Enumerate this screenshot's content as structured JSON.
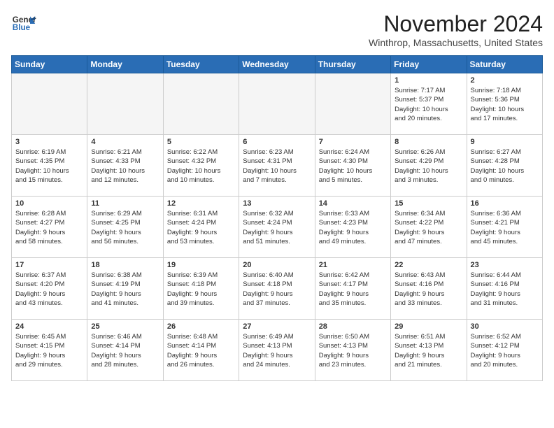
{
  "header": {
    "logo_general": "General",
    "logo_blue": "Blue",
    "month_title": "November 2024",
    "location": "Winthrop, Massachusetts, United States"
  },
  "weekdays": [
    "Sunday",
    "Monday",
    "Tuesday",
    "Wednesday",
    "Thursday",
    "Friday",
    "Saturday"
  ],
  "weeks": [
    [
      {
        "day": "",
        "info": ""
      },
      {
        "day": "",
        "info": ""
      },
      {
        "day": "",
        "info": ""
      },
      {
        "day": "",
        "info": ""
      },
      {
        "day": "",
        "info": ""
      },
      {
        "day": "1",
        "info": "Sunrise: 7:17 AM\nSunset: 5:37 PM\nDaylight: 10 hours\nand 20 minutes."
      },
      {
        "day": "2",
        "info": "Sunrise: 7:18 AM\nSunset: 5:36 PM\nDaylight: 10 hours\nand 17 minutes."
      }
    ],
    [
      {
        "day": "3",
        "info": "Sunrise: 6:19 AM\nSunset: 4:35 PM\nDaylight: 10 hours\nand 15 minutes."
      },
      {
        "day": "4",
        "info": "Sunrise: 6:21 AM\nSunset: 4:33 PM\nDaylight: 10 hours\nand 12 minutes."
      },
      {
        "day": "5",
        "info": "Sunrise: 6:22 AM\nSunset: 4:32 PM\nDaylight: 10 hours\nand 10 minutes."
      },
      {
        "day": "6",
        "info": "Sunrise: 6:23 AM\nSunset: 4:31 PM\nDaylight: 10 hours\nand 7 minutes."
      },
      {
        "day": "7",
        "info": "Sunrise: 6:24 AM\nSunset: 4:30 PM\nDaylight: 10 hours\nand 5 minutes."
      },
      {
        "day": "8",
        "info": "Sunrise: 6:26 AM\nSunset: 4:29 PM\nDaylight: 10 hours\nand 3 minutes."
      },
      {
        "day": "9",
        "info": "Sunrise: 6:27 AM\nSunset: 4:28 PM\nDaylight: 10 hours\nand 0 minutes."
      }
    ],
    [
      {
        "day": "10",
        "info": "Sunrise: 6:28 AM\nSunset: 4:27 PM\nDaylight: 9 hours\nand 58 minutes."
      },
      {
        "day": "11",
        "info": "Sunrise: 6:29 AM\nSunset: 4:25 PM\nDaylight: 9 hours\nand 56 minutes."
      },
      {
        "day": "12",
        "info": "Sunrise: 6:31 AM\nSunset: 4:24 PM\nDaylight: 9 hours\nand 53 minutes."
      },
      {
        "day": "13",
        "info": "Sunrise: 6:32 AM\nSunset: 4:24 PM\nDaylight: 9 hours\nand 51 minutes."
      },
      {
        "day": "14",
        "info": "Sunrise: 6:33 AM\nSunset: 4:23 PM\nDaylight: 9 hours\nand 49 minutes."
      },
      {
        "day": "15",
        "info": "Sunrise: 6:34 AM\nSunset: 4:22 PM\nDaylight: 9 hours\nand 47 minutes."
      },
      {
        "day": "16",
        "info": "Sunrise: 6:36 AM\nSunset: 4:21 PM\nDaylight: 9 hours\nand 45 minutes."
      }
    ],
    [
      {
        "day": "17",
        "info": "Sunrise: 6:37 AM\nSunset: 4:20 PM\nDaylight: 9 hours\nand 43 minutes."
      },
      {
        "day": "18",
        "info": "Sunrise: 6:38 AM\nSunset: 4:19 PM\nDaylight: 9 hours\nand 41 minutes."
      },
      {
        "day": "19",
        "info": "Sunrise: 6:39 AM\nSunset: 4:18 PM\nDaylight: 9 hours\nand 39 minutes."
      },
      {
        "day": "20",
        "info": "Sunrise: 6:40 AM\nSunset: 4:18 PM\nDaylight: 9 hours\nand 37 minutes."
      },
      {
        "day": "21",
        "info": "Sunrise: 6:42 AM\nSunset: 4:17 PM\nDaylight: 9 hours\nand 35 minutes."
      },
      {
        "day": "22",
        "info": "Sunrise: 6:43 AM\nSunset: 4:16 PM\nDaylight: 9 hours\nand 33 minutes."
      },
      {
        "day": "23",
        "info": "Sunrise: 6:44 AM\nSunset: 4:16 PM\nDaylight: 9 hours\nand 31 minutes."
      }
    ],
    [
      {
        "day": "24",
        "info": "Sunrise: 6:45 AM\nSunset: 4:15 PM\nDaylight: 9 hours\nand 29 minutes."
      },
      {
        "day": "25",
        "info": "Sunrise: 6:46 AM\nSunset: 4:14 PM\nDaylight: 9 hours\nand 28 minutes."
      },
      {
        "day": "26",
        "info": "Sunrise: 6:48 AM\nSunset: 4:14 PM\nDaylight: 9 hours\nand 26 minutes."
      },
      {
        "day": "27",
        "info": "Sunrise: 6:49 AM\nSunset: 4:13 PM\nDaylight: 9 hours\nand 24 minutes."
      },
      {
        "day": "28",
        "info": "Sunrise: 6:50 AM\nSunset: 4:13 PM\nDaylight: 9 hours\nand 23 minutes."
      },
      {
        "day": "29",
        "info": "Sunrise: 6:51 AM\nSunset: 4:13 PM\nDaylight: 9 hours\nand 21 minutes."
      },
      {
        "day": "30",
        "info": "Sunrise: 6:52 AM\nSunset: 4:12 PM\nDaylight: 9 hours\nand 20 minutes."
      }
    ]
  ]
}
